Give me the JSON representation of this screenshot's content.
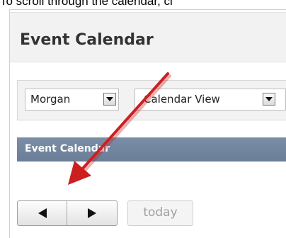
{
  "caption": {
    "text": "To scroll through the calendar, cl"
  },
  "header": {
    "title": "Event Calendar"
  },
  "filters": {
    "person": {
      "selected": "Morgan"
    },
    "view": {
      "selected": "Calendar View"
    }
  },
  "calendar": {
    "section_title": "Event Calendar",
    "nav": {
      "prev_icon": "left-triangle-icon",
      "next_icon": "right-triangle-icon"
    },
    "today_label": "today"
  },
  "colors": {
    "header_bar": "#6a7e98",
    "annotation_arrow": "#cc1f1f",
    "today_text": "#a0a0a0"
  }
}
